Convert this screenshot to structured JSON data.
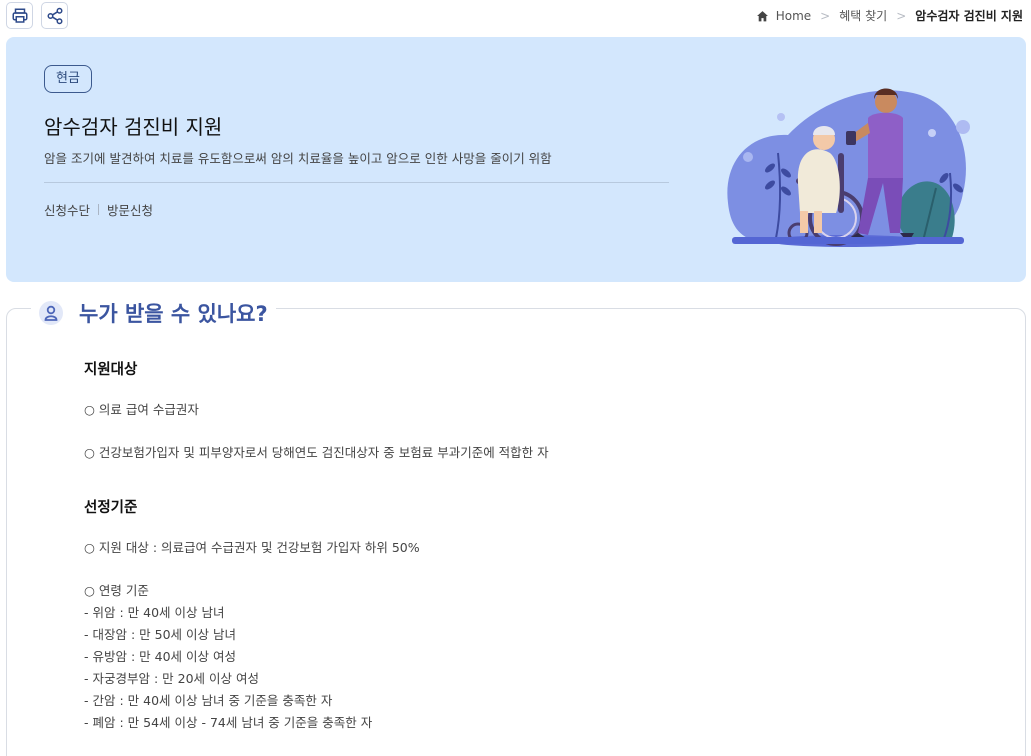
{
  "toolbar": {
    "print_icon": "printer-icon",
    "share_icon": "share-icon"
  },
  "breadcrumb": {
    "home": "Home",
    "level1": "혜택 찾기",
    "current": "암수검자 검진비 지원"
  },
  "hero": {
    "badge": "현금",
    "title": "암수검자 검진비 지원",
    "description": "암을 조기에 발견하여 치료를 유도함으로써 암의 치료율을 높이고 암으로 인한 사망을 줄이기 위함",
    "meta_label": "신청수단",
    "meta_value": "방문신청",
    "colors": {
      "background": "#d3e7fd",
      "accent": "#3b55a0"
    }
  },
  "section": {
    "title": "누가 받을 수 있나요?",
    "icon": "person-icon",
    "target": {
      "title": "지원대상",
      "lines": [
        "○ 의료 급여 수급권자",
        "○ 건강보험가입자 및 피부양자로서 당해연도 검진대상자 중 보험료 부과기준에 적합한 자"
      ]
    },
    "criteria": {
      "title": "선정기준",
      "lines": [
        "○ 지원 대상 : 의료급여 수급권자 및 건강보험 가입자 하위 50%",
        "○ 연령 기준",
        "- 위암 : 만 40세 이상 남녀",
        "- 대장암 : 만 50세 이상 남녀",
        "- 유방암 : 만 40세 이상 여성",
        "- 자궁경부암 : 만 20세 이상 여성",
        "- 간암 : 만 40세 이상 남녀 중 기준을 충족한 자",
        "- 폐암 : 만 54세 이상 - 74세 남녀 중 기준을 충족한 자"
      ]
    }
  }
}
